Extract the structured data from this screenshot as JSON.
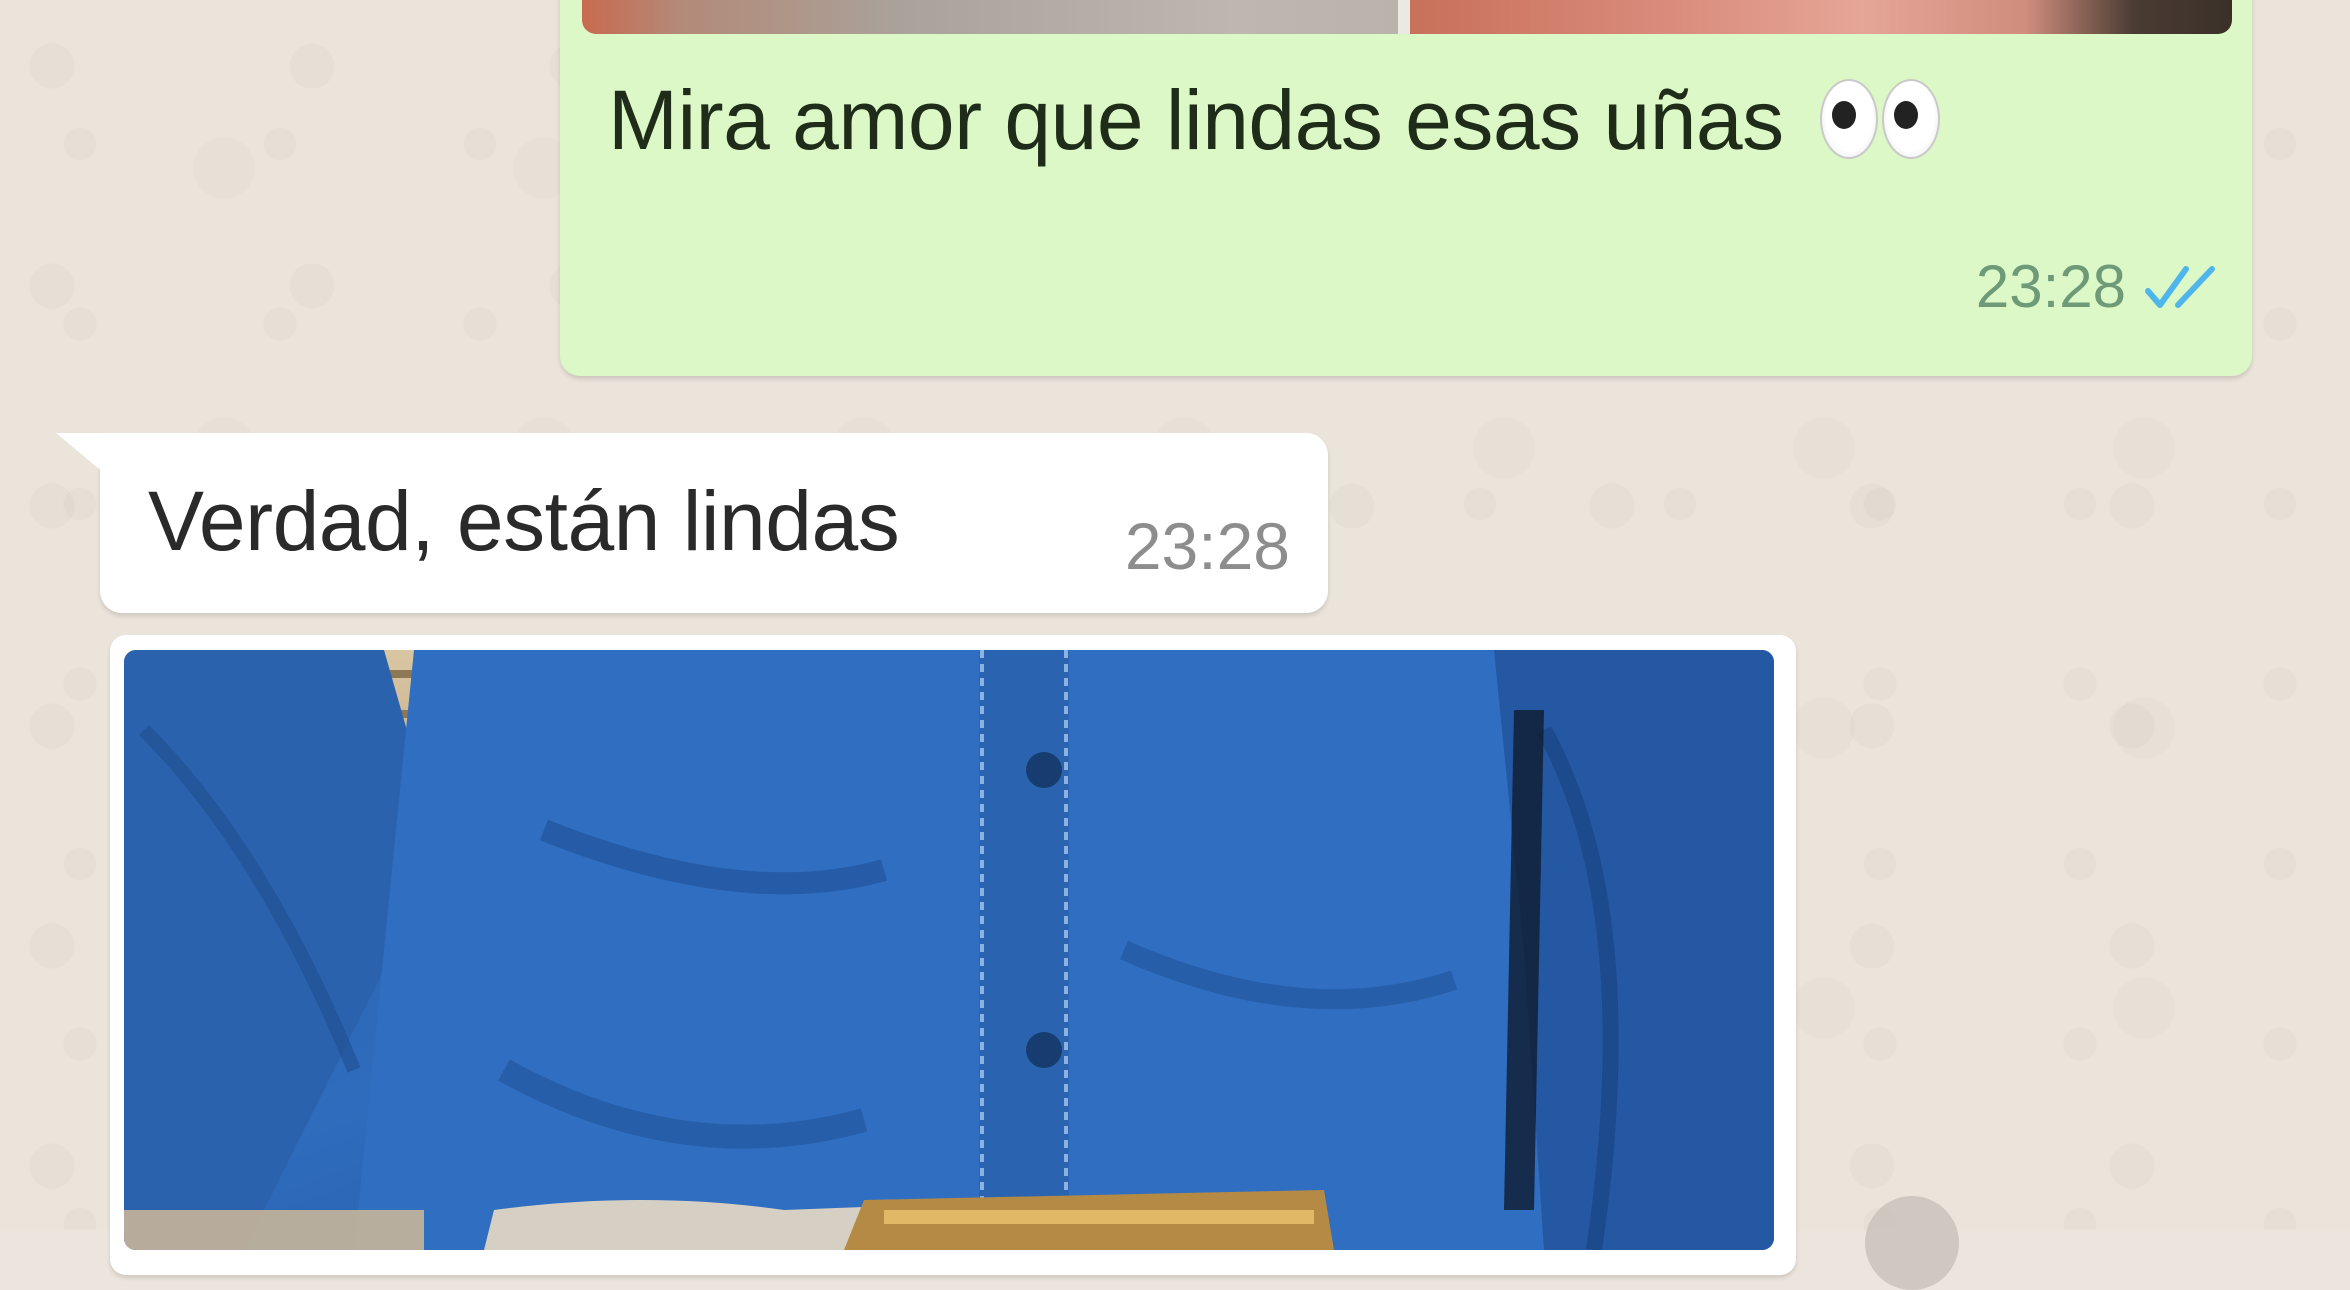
{
  "chat": {
    "messages": [
      {
        "direction": "outgoing",
        "type": "image_with_caption",
        "caption": "Mira amor que lindas esas uñas",
        "emoji": "eyes",
        "time": "23:28",
        "status": "read"
      },
      {
        "direction": "incoming",
        "type": "text",
        "text": "Verdad, están lindas",
        "time": "23:28"
      },
      {
        "direction": "incoming",
        "type": "image"
      }
    ]
  },
  "colors": {
    "outgoing_bubble": "#dcf8c6",
    "incoming_bubble": "#ffffff",
    "background": "#ece5dd",
    "read_ticks": "#4fb6ec"
  },
  "icons": {
    "read_receipt": "double-check-icon",
    "emoji": "eyes-emoji-icon"
  }
}
